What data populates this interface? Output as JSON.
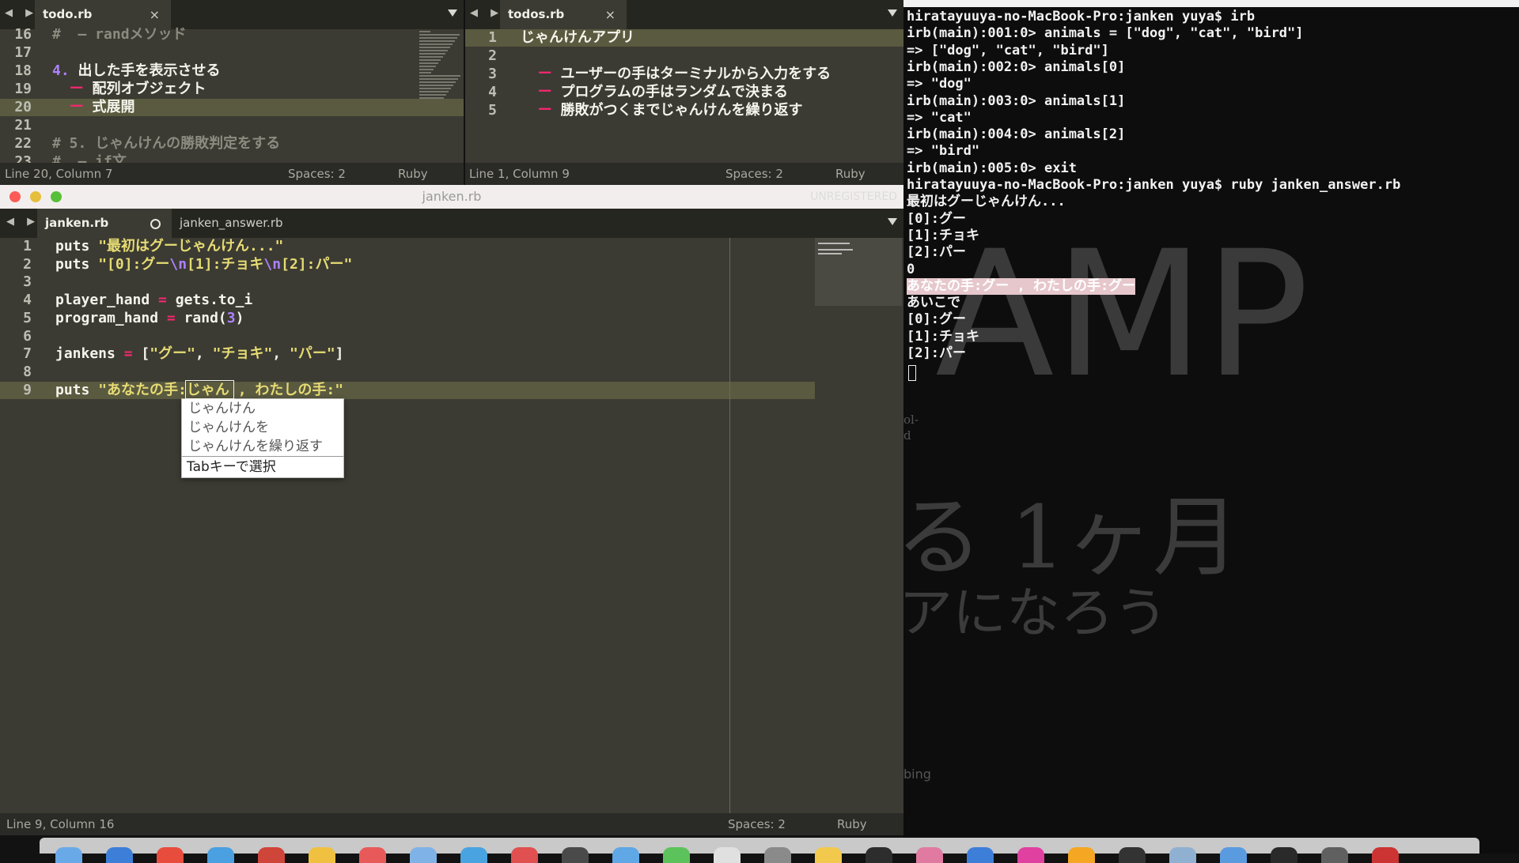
{
  "top_left": {
    "tab": "todo.rb",
    "lines": [
      {
        "n": "16",
        "t": "#  ― randメソッド",
        "cls": "cmt"
      },
      {
        "n": "17",
        "t": "",
        "cls": ""
      },
      {
        "n": "18",
        "t": "4. 出した手を表示させる",
        "cls": "num-first"
      },
      {
        "n": "19",
        "t": "  ー 配列オブジェクト",
        "cls": "dash"
      },
      {
        "n": "20",
        "t": "  ー 式展開",
        "cls": "dash",
        "hl": true
      },
      {
        "n": "21",
        "t": "",
        "cls": ""
      },
      {
        "n": "22",
        "t": "# 5. じゃんけんの勝敗判定をする",
        "cls": "cmt"
      },
      {
        "n": "23",
        "t": "#  ― if文",
        "cls": "cmt"
      }
    ],
    "status": {
      "position": "Line 20, Column 7",
      "spaces": "Spaces: 2",
      "syntax": "Ruby"
    }
  },
  "top_right": {
    "tab": "todos.rb",
    "lines": [
      {
        "n": "1",
        "t": "じゃんけんアプリ",
        "cls": "",
        "hl": true
      },
      {
        "n": "2",
        "t": "",
        "cls": ""
      },
      {
        "n": "3",
        "t": "  ー ユーザーの手はターミナルから入力をする",
        "cls": "dash"
      },
      {
        "n": "4",
        "t": "  ー プログラムの手はランダムで決まる",
        "cls": "dash"
      },
      {
        "n": "5",
        "t": "  ー 勝敗がつくまでじゃんけんを繰り返す",
        "cls": "dash"
      }
    ],
    "status": {
      "position": "Line 1, Column 9",
      "spaces": "Spaces: 2",
      "syntax": "Ruby"
    }
  },
  "main": {
    "window_title": "janken.rb",
    "unregistered": "UNREGISTERED",
    "tabs": [
      "janken.rb",
      "janken_answer.rb"
    ],
    "lines": [
      {
        "n": "1",
        "parts": [
          [
            "puts ",
            ""
          ],
          [
            "\"最初はグーじゃんけん...\"",
            "str"
          ]
        ]
      },
      {
        "n": "2",
        "parts": [
          [
            "puts ",
            ""
          ],
          [
            "\"[0]:グー",
            "str"
          ],
          [
            "\\n",
            "num"
          ],
          [
            "[1]:チョキ",
            "str"
          ],
          [
            "\\n",
            "num"
          ],
          [
            "[2]:パー\"",
            "str"
          ]
        ]
      },
      {
        "n": "3",
        "parts": []
      },
      {
        "n": "4",
        "parts": [
          [
            "player_hand ",
            ""
          ],
          [
            "=",
            "op"
          ],
          [
            " gets.to_i",
            ""
          ]
        ]
      },
      {
        "n": "5",
        "parts": [
          [
            "program_hand ",
            ""
          ],
          [
            "=",
            "op"
          ],
          [
            " rand(",
            ""
          ],
          [
            "3",
            "num"
          ],
          [
            ")",
            ""
          ]
        ]
      },
      {
        "n": "6",
        "parts": []
      },
      {
        "n": "7",
        "parts": [
          [
            "jankens ",
            ""
          ],
          [
            "=",
            "op"
          ],
          [
            " [",
            ""
          ],
          [
            "\"グー\"",
            "str"
          ],
          [
            ", ",
            ""
          ],
          [
            "\"チョキ\"",
            "str"
          ],
          [
            ", ",
            ""
          ],
          [
            "\"パー\"",
            "str"
          ],
          [
            "]",
            ""
          ]
        ]
      },
      {
        "n": "8",
        "parts": []
      },
      {
        "n": "9",
        "parts": [
          [
            "puts ",
            ""
          ],
          [
            "\"あなたの手:じゃん , わたしの手:\"",
            "str"
          ]
        ],
        "hl": true
      }
    ],
    "autocomplete": {
      "items": [
        "じゃんけん",
        "じゃんけんを",
        "じゃんけんを繰り返す"
      ],
      "footer": "Tabキーで選択"
    },
    "status": {
      "position": "Line 9, Column 16",
      "spaces": "Spaces: 2",
      "syntax": "Ruby"
    }
  },
  "terminal": {
    "lines": [
      {
        "t": "hiratayuuya-no-MacBook-Pro:janken yuya$ irb"
      },
      {
        "t": "irb(main):001:0> animals = [\"dog\", \"cat\", \"bird\"]"
      },
      {
        "t": "=> [\"dog\", \"cat\", \"bird\"]"
      },
      {
        "t": "irb(main):002:0> animals[0]"
      },
      {
        "t": "=> \"dog\""
      },
      {
        "t": "irb(main):003:0> animals[1]"
      },
      {
        "t": "=> \"cat\""
      },
      {
        "t": "irb(main):004:0> animals[2]"
      },
      {
        "t": "=> \"bird\""
      },
      {
        "t": "irb(main):005:0> exit"
      },
      {
        "t": "hiratayuuya-no-MacBook-Pro:janken yuya$ ruby janken_answer.rb"
      },
      {
        "t": "最初はグーじゃんけん..."
      },
      {
        "t": "[0]:グー"
      },
      {
        "t": "[1]:チョキ"
      },
      {
        "t": "[2]:パー"
      },
      {
        "t": "0"
      },
      {
        "t": "あなたの手:グー , わたしの手:グー",
        "sel": true
      },
      {
        "t": "あいこで"
      },
      {
        "t": "[0]:グー"
      },
      {
        "t": "[1]:チョキ"
      },
      {
        "t": "[2]:パー"
      }
    ],
    "wallpaper": {
      "big": "AMP",
      "month": "る 1ヶ月",
      "bottom": "アになろう",
      "side1": "ol-",
      "side2": "d",
      "side3": "bing"
    }
  },
  "colors": {
    "accent_pink": "#f92672",
    "string": "#e6db74",
    "number": "#ae81ff"
  }
}
